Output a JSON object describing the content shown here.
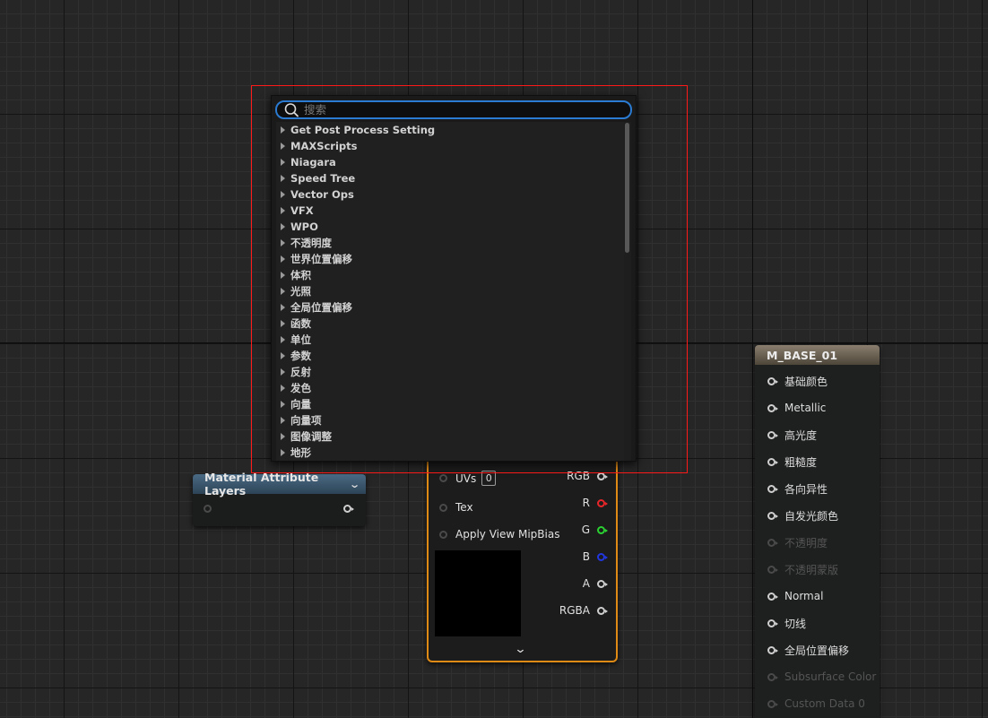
{
  "search": {
    "placeholder": "搜索",
    "value": ""
  },
  "categories": [
    "Get Post Process Setting",
    "MAXScripts",
    "Niagara",
    "Speed Tree",
    "Vector Ops",
    "VFX",
    "WPO",
    "不透明度",
    "世界位置偏移",
    "体积",
    "光照",
    "全局位置偏移",
    "函数",
    "单位",
    "参数",
    "反射",
    "发色",
    "向量",
    "向量项",
    "图像调整",
    "地形"
  ],
  "material_layers_node": {
    "title": "Material Attribute Layers"
  },
  "texture_node": {
    "inputs": {
      "uvs": "UVs",
      "uvs_value": "0",
      "tex": "Tex",
      "mip": "Apply View MipBias"
    },
    "outputs": {
      "rgb": "RGB",
      "r": "R",
      "g": "G",
      "b": "B",
      "a": "A",
      "rgba": "RGBA"
    },
    "colors": {
      "r": "#e8262a",
      "g": "#2bd132",
      "b": "#2237e0",
      "border": "#e08a16"
    }
  },
  "material_node": {
    "title": "M_BASE_01",
    "pins": [
      {
        "label": "基础颜色",
        "enabled": true
      },
      {
        "label": "Metallic",
        "enabled": true
      },
      {
        "label": "高光度",
        "enabled": true
      },
      {
        "label": "粗糙度",
        "enabled": true
      },
      {
        "label": "各向异性",
        "enabled": true
      },
      {
        "label": "自发光颜色",
        "enabled": true
      },
      {
        "label": "不透明度",
        "enabled": false
      },
      {
        "label": "不透明蒙版",
        "enabled": false
      },
      {
        "label": "Normal",
        "enabled": true
      },
      {
        "label": "切线",
        "enabled": true
      },
      {
        "label": "全局位置偏移",
        "enabled": true
      },
      {
        "label": "Subsurface Color",
        "enabled": false
      },
      {
        "label": "Custom Data 0",
        "enabled": false
      }
    ]
  },
  "colors": {
    "selection": "#ff1a1a",
    "search_focus": "#2a7bd1",
    "canvas": "#262626"
  }
}
